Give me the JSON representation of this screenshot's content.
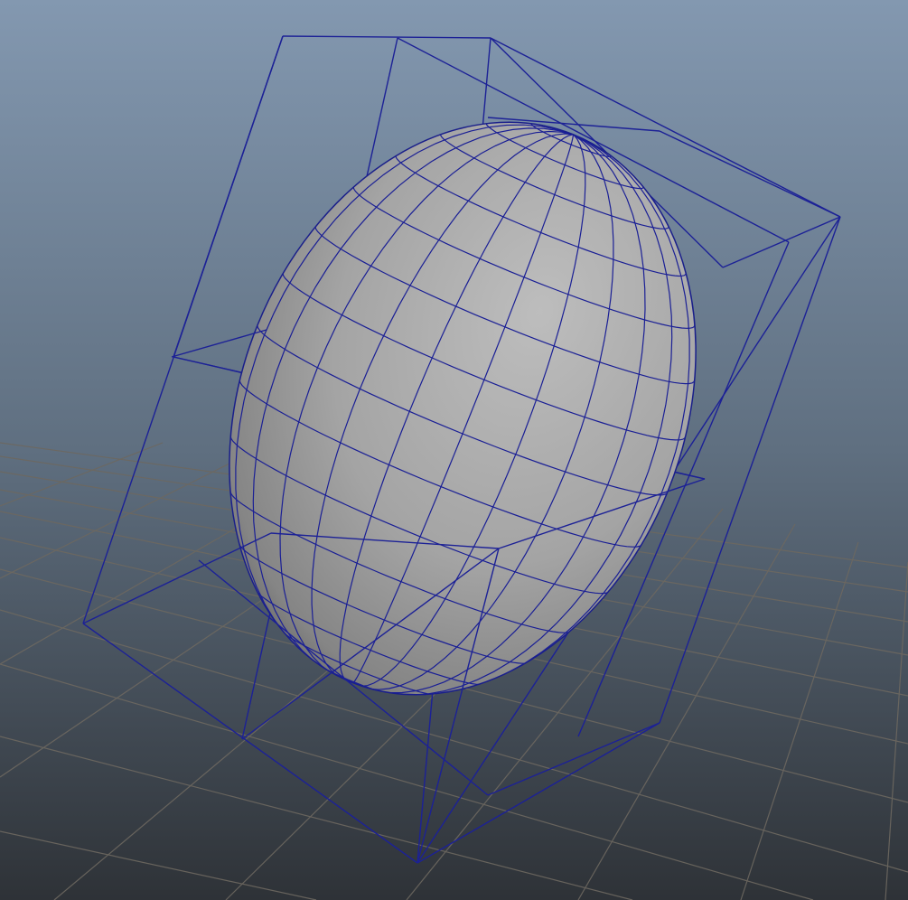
{
  "viewport": {
    "background_top": "#8398b0",
    "background_bottom": "#2f3338",
    "grid_color": "#6f6a60",
    "selection_wire_color": "#1a1f95",
    "surface_light": "#b9b9b9",
    "surface_dark": "#5f5f5f"
  },
  "scene": {
    "grid": {
      "visible": true
    },
    "object": {
      "shape": "sphere",
      "display": "smooth-shaded-with-wireframe",
      "selected": true
    },
    "lattice": {
      "visible": true,
      "divisions": [
        2,
        2,
        2
      ]
    }
  }
}
